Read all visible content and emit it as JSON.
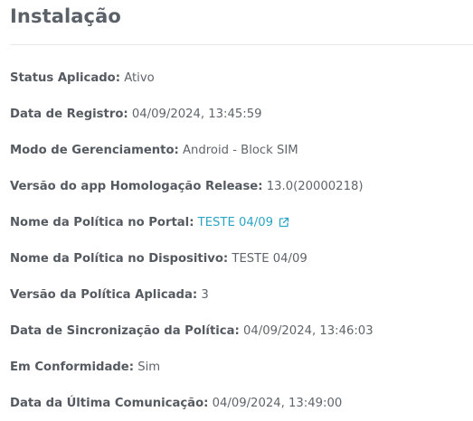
{
  "section": {
    "title": "Instalação"
  },
  "fields": {
    "status": {
      "label": "Status Aplicado:",
      "value": "Ativo"
    },
    "registration_date": {
      "label": "Data de Registro:",
      "value": "04/09/2024, 13:45:59"
    },
    "management_mode": {
      "label": "Modo de Gerenciamento:",
      "value": "Android - Block SIM"
    },
    "app_version": {
      "label": "Versão do app Homologação Release:",
      "value": "13.0(20000218)"
    },
    "portal_policy": {
      "label": "Nome da Política no Portal:",
      "value": "TESTE 04/09",
      "icon": "external-link-icon"
    },
    "device_policy": {
      "label": "Nome da Política no Dispositivo:",
      "value": "TESTE 04/09"
    },
    "policy_version": {
      "label": "Versão da Política Aplicada:",
      "value": "3"
    },
    "policy_sync_date": {
      "label": "Data de Sincronização da Política:",
      "value": "04/09/2024, 13:46:03"
    },
    "compliance": {
      "label": "Em Conformidade:",
      "value": "Sim"
    },
    "last_communication": {
      "label": "Data da Última Comunicação:",
      "value": "04/09/2024, 13:49:00"
    }
  },
  "colors": {
    "text": "#555a60",
    "link": "#2ba4c6",
    "divider": "#e6e8eb"
  }
}
